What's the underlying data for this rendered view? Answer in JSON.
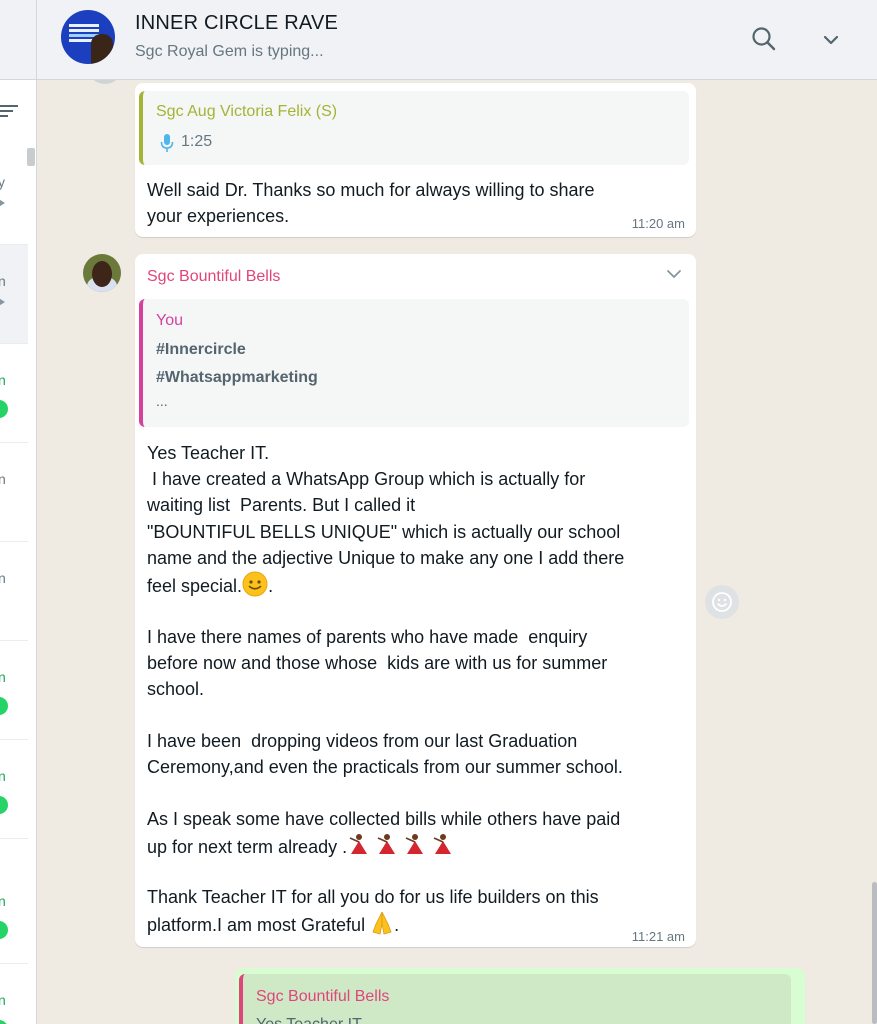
{
  "header": {
    "title": "INNER CIRCLE RAVE",
    "subtitle": "Sgc Royal Gem is typing...",
    "search_icon": "search-icon",
    "menu_icon": "chevron-down-icon"
  },
  "sidebar": {
    "items": [
      {
        "letter": "y",
        "color": "gray"
      },
      {
        "letter": "n",
        "color": "gray",
        "active": true
      },
      {
        "letter": "n",
        "color": "green",
        "unread": true
      },
      {
        "letter": "n",
        "color": "gray"
      },
      {
        "letter": "n",
        "color": "gray"
      },
      {
        "letter": "n",
        "color": "green",
        "unread": true
      },
      {
        "letter": "n",
        "color": "green",
        "unread": true
      },
      {
        "letter": "n",
        "color": "green",
        "unread": true
      },
      {
        "letter": "n",
        "color": "green",
        "unread": true
      }
    ]
  },
  "messages": [
    {
      "quote_author": "Sgc Aug Victoria Felix (S)",
      "quote_voice_duration": "1:25",
      "text": "Well said Dr. Thanks so much for always willing to share\nyour experiences.",
      "time": "11:20 am"
    },
    {
      "sender": "Sgc Bountiful Bells",
      "quote_author": "You",
      "quote_lines": [
        "#Innercircle",
        "#Whatsappmarketing",
        "..."
      ],
      "paragraphs": [
        "Yes Teacher IT.\n I have created a WhatsApp Group which is actually for\nwaiting list  Parents. But I called it\n\"BOUNTIFUL BELLS UNIQUE\" which is actually our school\nname and the adjective Unique to make any one I add there\nfeel special.",
        "I have there names of parents who have made  enquiry\nbefore now and those whose  kids are with us for summer\nschool.",
        "I have been  dropping videos from our last Graduation\nCeremony,and even the practicals from our summer school.",
        "As I speak some have collected bills while others have paid\nup for next term already .",
        "Thank Teacher IT for all you do for us life builders on this\nplatform.I am most Grateful "
      ],
      "p1_end": ".",
      "p5_end": ".",
      "time": "11:21 am"
    },
    {
      "quote_author": "Sgc Bountiful Bells",
      "quote_preview": "Yes Teacher IT"
    }
  ],
  "colors": {
    "chat_bg": "#efeae2",
    "header_bg": "#f0f2f5",
    "incoming": "#ffffff",
    "outgoing": "#d9fdd3",
    "quote_victoria": "#a5b337",
    "quote_you": "#d3439d",
    "sender_bells": "#e0457b",
    "unread_green": "#25d366"
  }
}
